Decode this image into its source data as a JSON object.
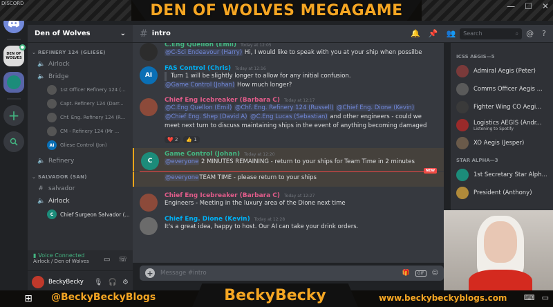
{
  "window": {
    "app_label": "DISCORD",
    "min": "—",
    "max": "☐",
    "close": "✕"
  },
  "stream": {
    "title": "DEN OF WOLVES MEGAGAME",
    "handle": "@BeckyBeckyBlogs",
    "brand": "BeckyBecky",
    "website": "www.beckybeckyblogs.com"
  },
  "servers": {
    "wolves_label": "DEN OF WOLVES"
  },
  "guild": {
    "name": "Den of Wolves",
    "chevron": "⌄"
  },
  "channels": {
    "cat1": "REFINERY 124 (GLIESE)",
    "cat1_items": [
      {
        "label": "Airlock"
      },
      {
        "label": "Bridge"
      }
    ],
    "bridge_users": [
      {
        "name": "1st Officer Refinery 124 (...",
        "initials": ""
      },
      {
        "name": "Capt. Refinery 124 (Darr...",
        "initials": ""
      },
      {
        "name": "Chf. Eng. Refinery 124 (R...",
        "initials": ""
      },
      {
        "name": "CM - Refinery 124 (Mr ...",
        "initials": ""
      },
      {
        "name": "Gliese Control (Jon)",
        "initials": "AI"
      }
    ],
    "refinery": "Refinery",
    "cat2": "SALVADOR (SAN)",
    "salvador": "salvador",
    "airlock2": "Airlock",
    "airlock2_users": [
      {
        "name": "Chief Surgeon Salvador (...",
        "initials": "C"
      }
    ]
  },
  "voice": {
    "status": "Voice Connected",
    "location": "Airlock / Den of Wolves"
  },
  "user": {
    "name": "BeckyBecky"
  },
  "header": {
    "channel": "intro",
    "search_placeholder": "Search"
  },
  "messages": [
    {
      "author": "C.Eng Quellon (Emil)",
      "time": "Today at 12:05",
      "mention": "@C-Sci Endeavour (Harry)",
      "text": " Hi, I would like to speak with you at your ship when possilbe"
    },
    {
      "author": "FAS Control (Chris)",
      "time": "Today at 12:16",
      "initials": "AI",
      "quote": "Turn 1 will be slightly longer to allow for any initial confusion.",
      "mention": "@Game Control (Johan)",
      "text": " How much longer?"
    },
    {
      "author": "Chief Eng Icebreaker (Barbara C)",
      "time": "Today at 12:17",
      "mentions": [
        "@C.Eng Quellon (Emil)",
        "@Chf. Eng. Refinery 124 (Russell)",
        "@Chief Eng. Dione (Kevin)",
        "@Chief Eng. Shep (David A)",
        "@C.Eng Lucas (Sebastian)"
      ],
      "text": " and other engineers - could we meet next turn to discuss maintaining ships in the event of anything becoming damaged",
      "reactions": [
        "❤️ 2",
        "👍 1"
      ]
    },
    {
      "author": "Game Control (Johan)",
      "time": "Today at 12:20",
      "initials": "C",
      "mention": "@everyone",
      "text": " 2 MINUTES REMAINING - return to your ships for Team Time in 2 minutes",
      "new_label": "NEW",
      "cont_mention": "@everyone",
      "cont_text": "TEAM TIME - please return to your ships"
    },
    {
      "author": "Chief Eng Icebreaker (Barbara C)",
      "time": "Today at 12:27",
      "text": "Engineers - Meeting in the luxury area of the Dione next time"
    },
    {
      "author": "Chief Eng. Dione (Kevin)",
      "time": "Today at 12:28",
      "text": "It's a great idea, happy to host.  Our AI can take your drink orders."
    }
  ],
  "composer": {
    "placeholder": "Message #intro",
    "gif": "GIF"
  },
  "members": {
    "group1": "ICSS AEGIS—5",
    "group1_items": [
      {
        "name": "Admiral Aegis (Peter)",
        "sub": ""
      },
      {
        "name": "Comms Officer Aegis ...",
        "sub": ""
      },
      {
        "name": "Fighter Wing CO Aegi...",
        "sub": ""
      },
      {
        "name": "Logistics AEGIS (Andr...",
        "sub": "Listening to Spotify"
      },
      {
        "name": "XO Aegis (Jesper)",
        "sub": ""
      }
    ],
    "group2": "STAR ALPHA—3",
    "group2_items": [
      {
        "name": "1st Secretary Star Alph..."
      },
      {
        "name": "President (Anthony)"
      }
    ]
  }
}
